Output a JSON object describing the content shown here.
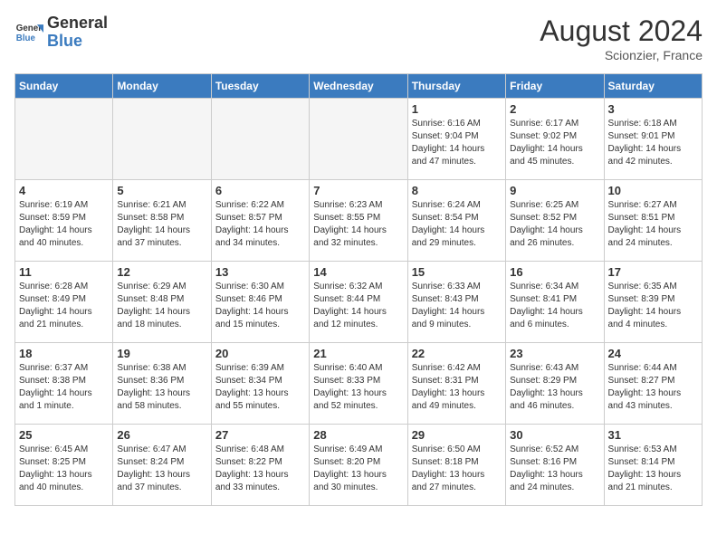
{
  "header": {
    "logo_line1": "General",
    "logo_line2": "Blue",
    "month_year": "August 2024",
    "location": "Scionzier, France"
  },
  "weekdays": [
    "Sunday",
    "Monday",
    "Tuesday",
    "Wednesday",
    "Thursday",
    "Friday",
    "Saturday"
  ],
  "weeks": [
    [
      {
        "day": "",
        "info": ""
      },
      {
        "day": "",
        "info": ""
      },
      {
        "day": "",
        "info": ""
      },
      {
        "day": "",
        "info": ""
      },
      {
        "day": "1",
        "info": "Sunrise: 6:16 AM\nSunset: 9:04 PM\nDaylight: 14 hours\nand 47 minutes."
      },
      {
        "day": "2",
        "info": "Sunrise: 6:17 AM\nSunset: 9:02 PM\nDaylight: 14 hours\nand 45 minutes."
      },
      {
        "day": "3",
        "info": "Sunrise: 6:18 AM\nSunset: 9:01 PM\nDaylight: 14 hours\nand 42 minutes."
      }
    ],
    [
      {
        "day": "4",
        "info": "Sunrise: 6:19 AM\nSunset: 8:59 PM\nDaylight: 14 hours\nand 40 minutes."
      },
      {
        "day": "5",
        "info": "Sunrise: 6:21 AM\nSunset: 8:58 PM\nDaylight: 14 hours\nand 37 minutes."
      },
      {
        "day": "6",
        "info": "Sunrise: 6:22 AM\nSunset: 8:57 PM\nDaylight: 14 hours\nand 34 minutes."
      },
      {
        "day": "7",
        "info": "Sunrise: 6:23 AM\nSunset: 8:55 PM\nDaylight: 14 hours\nand 32 minutes."
      },
      {
        "day": "8",
        "info": "Sunrise: 6:24 AM\nSunset: 8:54 PM\nDaylight: 14 hours\nand 29 minutes."
      },
      {
        "day": "9",
        "info": "Sunrise: 6:25 AM\nSunset: 8:52 PM\nDaylight: 14 hours\nand 26 minutes."
      },
      {
        "day": "10",
        "info": "Sunrise: 6:27 AM\nSunset: 8:51 PM\nDaylight: 14 hours\nand 24 minutes."
      }
    ],
    [
      {
        "day": "11",
        "info": "Sunrise: 6:28 AM\nSunset: 8:49 PM\nDaylight: 14 hours\nand 21 minutes."
      },
      {
        "day": "12",
        "info": "Sunrise: 6:29 AM\nSunset: 8:48 PM\nDaylight: 14 hours\nand 18 minutes."
      },
      {
        "day": "13",
        "info": "Sunrise: 6:30 AM\nSunset: 8:46 PM\nDaylight: 14 hours\nand 15 minutes."
      },
      {
        "day": "14",
        "info": "Sunrise: 6:32 AM\nSunset: 8:44 PM\nDaylight: 14 hours\nand 12 minutes."
      },
      {
        "day": "15",
        "info": "Sunrise: 6:33 AM\nSunset: 8:43 PM\nDaylight: 14 hours\nand 9 minutes."
      },
      {
        "day": "16",
        "info": "Sunrise: 6:34 AM\nSunset: 8:41 PM\nDaylight: 14 hours\nand 6 minutes."
      },
      {
        "day": "17",
        "info": "Sunrise: 6:35 AM\nSunset: 8:39 PM\nDaylight: 14 hours\nand 4 minutes."
      }
    ],
    [
      {
        "day": "18",
        "info": "Sunrise: 6:37 AM\nSunset: 8:38 PM\nDaylight: 14 hours\nand 1 minute."
      },
      {
        "day": "19",
        "info": "Sunrise: 6:38 AM\nSunset: 8:36 PM\nDaylight: 13 hours\nand 58 minutes."
      },
      {
        "day": "20",
        "info": "Sunrise: 6:39 AM\nSunset: 8:34 PM\nDaylight: 13 hours\nand 55 minutes."
      },
      {
        "day": "21",
        "info": "Sunrise: 6:40 AM\nSunset: 8:33 PM\nDaylight: 13 hours\nand 52 minutes."
      },
      {
        "day": "22",
        "info": "Sunrise: 6:42 AM\nSunset: 8:31 PM\nDaylight: 13 hours\nand 49 minutes."
      },
      {
        "day": "23",
        "info": "Sunrise: 6:43 AM\nSunset: 8:29 PM\nDaylight: 13 hours\nand 46 minutes."
      },
      {
        "day": "24",
        "info": "Sunrise: 6:44 AM\nSunset: 8:27 PM\nDaylight: 13 hours\nand 43 minutes."
      }
    ],
    [
      {
        "day": "25",
        "info": "Sunrise: 6:45 AM\nSunset: 8:25 PM\nDaylight: 13 hours\nand 40 minutes."
      },
      {
        "day": "26",
        "info": "Sunrise: 6:47 AM\nSunset: 8:24 PM\nDaylight: 13 hours\nand 37 minutes."
      },
      {
        "day": "27",
        "info": "Sunrise: 6:48 AM\nSunset: 8:22 PM\nDaylight: 13 hours\nand 33 minutes."
      },
      {
        "day": "28",
        "info": "Sunrise: 6:49 AM\nSunset: 8:20 PM\nDaylight: 13 hours\nand 30 minutes."
      },
      {
        "day": "29",
        "info": "Sunrise: 6:50 AM\nSunset: 8:18 PM\nDaylight: 13 hours\nand 27 minutes."
      },
      {
        "day": "30",
        "info": "Sunrise: 6:52 AM\nSunset: 8:16 PM\nDaylight: 13 hours\nand 24 minutes."
      },
      {
        "day": "31",
        "info": "Sunrise: 6:53 AM\nSunset: 8:14 PM\nDaylight: 13 hours\nand 21 minutes."
      }
    ]
  ]
}
